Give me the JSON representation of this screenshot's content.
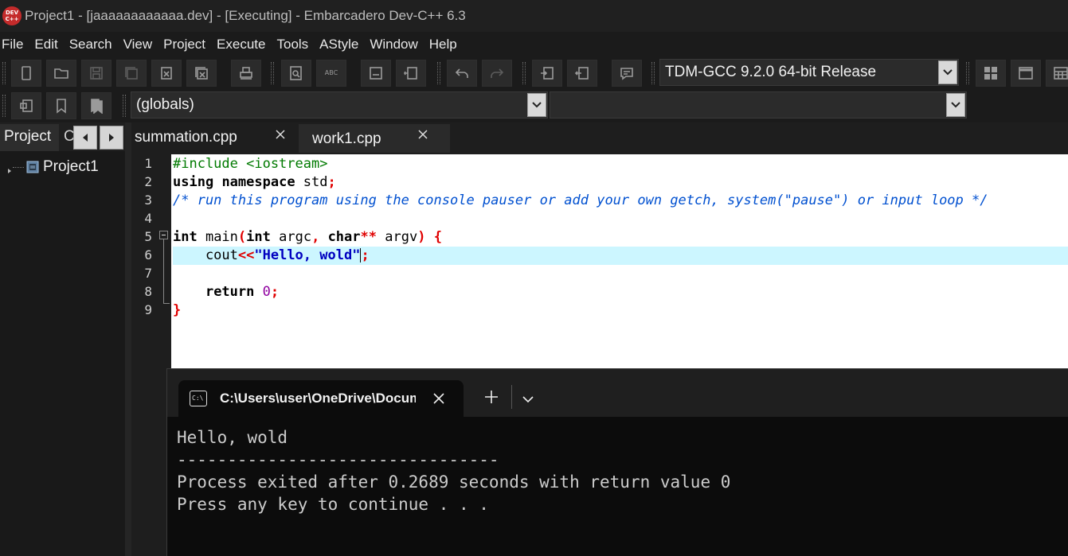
{
  "window": {
    "logo_text": "DEV C++",
    "title": "Project1 - [jaaaaaaaaaaaa.dev] - [Executing] - Embarcadero Dev-C++ 6.3"
  },
  "menu": [
    "File",
    "Edit",
    "Search",
    "View",
    "Project",
    "Execute",
    "Tools",
    "AStyle",
    "Window",
    "Help"
  ],
  "toolbar": {
    "compiler_select": "TDM-GCC 9.2.0 64-bit Release",
    "scope_select": "(globals)",
    "member_select": "",
    "spellcheck_icon_text": "ABC"
  },
  "left_panel": {
    "tabs": [
      "Project",
      "C"
    ],
    "tree": [
      {
        "label": "Project1",
        "icon": "project-icon"
      }
    ]
  },
  "editor": {
    "tabs": [
      {
        "label": "summation.cpp",
        "active": true
      },
      {
        "label": "work1.cpp",
        "active": false
      }
    ],
    "line_numbers": [
      "1",
      "2",
      "3",
      "4",
      "5",
      "6",
      "7",
      "8",
      "9"
    ],
    "active_line": 6
  },
  "console": {
    "tab_title": "C:\\Users\\user\\OneDrive\\Documents\\jaaaaaaaaaaaa.exe",
    "icon_text": "C:\\",
    "output": [
      "Hello, wold",
      "--------------------------------",
      "Process exited after 0.2689 seconds with return value 0",
      "Press any key to continue . . ."
    ]
  },
  "colors": {
    "background": "#1e1e1e",
    "editor_background": "#ffffff",
    "active_line": "#ccf6ff",
    "preprocessor": "#007a00",
    "comment": "#0050d0",
    "symbol": "#e00000",
    "string": "#0000c0",
    "number": "#9000a0",
    "console_background": "#0c0c0c"
  }
}
